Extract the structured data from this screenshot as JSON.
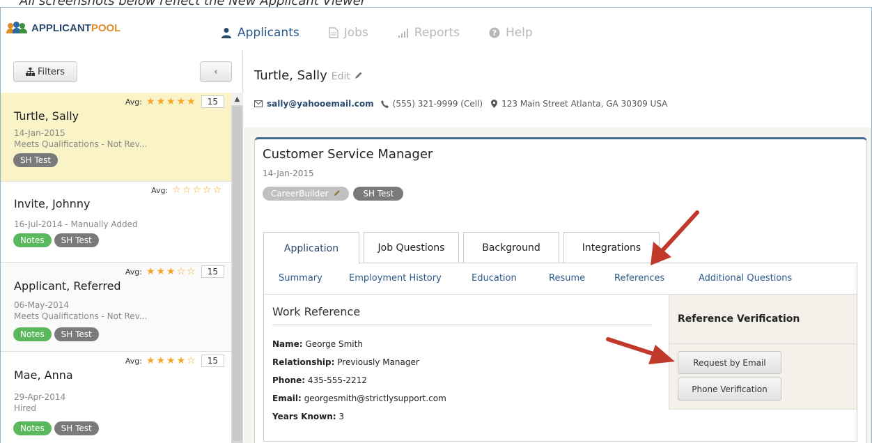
{
  "caption": "All screenshots below reflect the New Applicant Viewer",
  "logo": {
    "part1": "APPLICANT",
    "part2": "POOL"
  },
  "nav": [
    {
      "label": "Applicants",
      "icon": "user-icon",
      "active": true
    },
    {
      "label": "Jobs",
      "icon": "document-icon",
      "active": false
    },
    {
      "label": "Reports",
      "icon": "bar-chart-icon",
      "active": false
    },
    {
      "label": "Help",
      "icon": "question-circle-icon",
      "active": false
    }
  ],
  "sidebar": {
    "filters_label": "Filters",
    "collapse_label": "‹",
    "avg_label": "Avg:",
    "applicants": [
      {
        "name": "Turtle, Sally",
        "rating": 5,
        "count": "15",
        "date": "14-Jan-2015",
        "status": "Meets Qualifications - Not Rev...",
        "tags": [
          "SH Test"
        ],
        "selected": true
      },
      {
        "name": "Invite, Johnny",
        "rating": 0,
        "count": "",
        "date": "16-Jul-2014 - Manually Added",
        "status": "",
        "tags": [
          "Notes",
          "SH Test"
        ],
        "selected": false
      },
      {
        "name": "Applicant, Referred",
        "rating": 3,
        "count": "15",
        "date": "06-May-2014",
        "status": "Meets Qualifications - Not Rev...",
        "tags": [
          "Notes",
          "SH Test"
        ],
        "selected": false
      },
      {
        "name": "Mae, Anna",
        "rating": 4,
        "count": "15",
        "date": "29-Apr-2014",
        "status": "Hired",
        "tags": [
          "Notes",
          "SH Test"
        ],
        "selected": false
      }
    ]
  },
  "applicant": {
    "name": "Turtle, Sally",
    "edit_label": "Edit",
    "email": "sally@yahooemail.com",
    "phone": "(555) 321-9999 (Cell)",
    "address": "123 Main Street Atlanta, GA 30309 USA"
  },
  "job": {
    "title": "Customer Service Manager",
    "date": "14-Jan-2015",
    "source_tag": "CareerBuilder",
    "tag": "SH Test"
  },
  "tabs": [
    "Application",
    "Job Questions",
    "Background",
    "Integrations"
  ],
  "subtabs": [
    "Summary",
    "Employment History",
    "Education",
    "Resume",
    "References",
    "Additional Questions"
  ],
  "reference": {
    "title": "Work Reference",
    "name_label": "Name:",
    "name": "George Smith",
    "relationship_label": "Relationship:",
    "relationship": "Previously Manager",
    "phone_label": "Phone:",
    "phone": "435-555-2212",
    "email_label": "Email:",
    "email": "georgesmith@strictlysupport.com",
    "years_label": "Years Known:",
    "years": "3"
  },
  "verification": {
    "title": "Reference Verification",
    "email_button": "Request by Email",
    "phone_button": "Phone Verification"
  },
  "colors": {
    "accent": "#2a5a8a",
    "star": "#f5a623",
    "tag_green": "#5cb85c",
    "arrow": "#c0392b"
  }
}
